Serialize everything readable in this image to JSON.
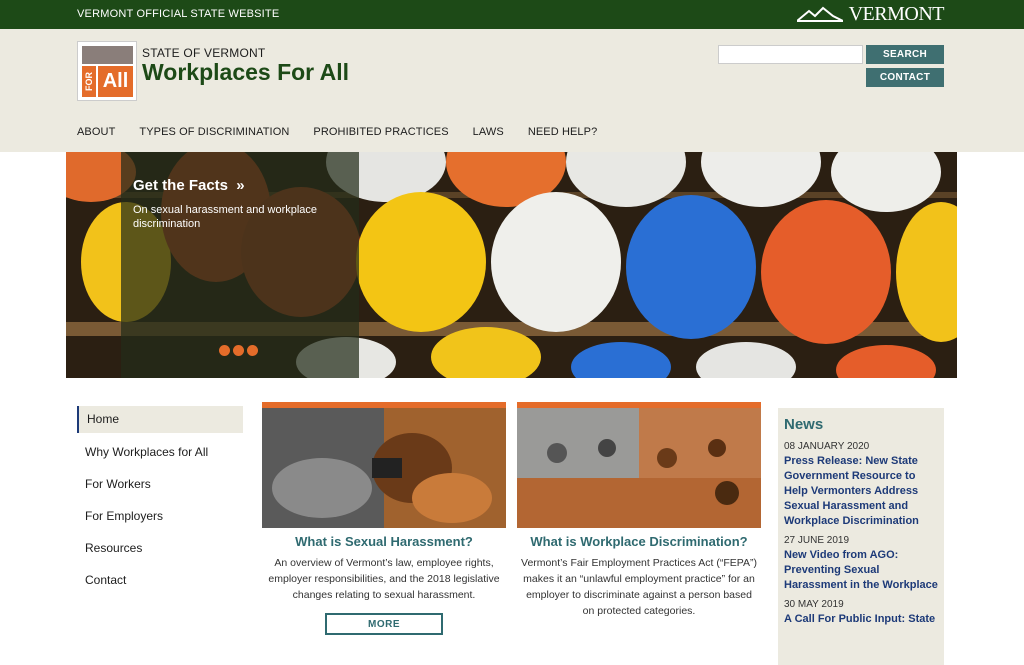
{
  "topbar": {
    "official": "VERMONT OFFICIAL STATE WEBSITE",
    "brand": "VERMONT"
  },
  "header": {
    "state": "STATE OF VERMONT",
    "title": "Workplaces For All",
    "logo_for": "FOR",
    "logo_all": "All",
    "search_label": "SEARCH",
    "contact_label": "CONTACT",
    "search_placeholder": ""
  },
  "nav": [
    "ABOUT",
    "TYPES OF DISCRIMINATION",
    "PROHIBITED PRACTICES",
    "LAWS",
    "NEED HELP?"
  ],
  "hero": {
    "title": "Get the Facts",
    "chevron": "»",
    "desc": "On sexual harassment and workplace discrimination",
    "slides": 3
  },
  "sidebar": [
    "Home",
    "Why Workplaces for All",
    "For Workers",
    "For Employers",
    "Resources",
    "Contact"
  ],
  "cards": [
    {
      "title": "What is Sexual Harassment?",
      "text": "An overview of Vermont’s law, employee rights, employer responsibilities, and the 2018 legislative changes relating to sexual harassment.",
      "button": "MORE"
    },
    {
      "title": "What is Workplace Discrimination?",
      "text": "Vermont’s Fair Employment Practices Act (“FEPA”) makes it an “unlawful employment practice” for an employer to discriminate against a person based on protected categories."
    }
  ],
  "news": {
    "title": "News",
    "items": [
      {
        "date": "08 JANUARY 2020",
        "headline": "Press Release: New State Government Resource to Help Vermonters Address Sexual Harassment and Workplace Discrimination"
      },
      {
        "date": "27 JUNE 2019",
        "headline": "New Video from AGO: Preventing Sexual Harassment in the Workplace"
      },
      {
        "date": "30 MAY 2019",
        "headline": "A Call For Public Input: State"
      }
    ]
  },
  "colors": {
    "topbar": "#1d4a17",
    "header_bg": "#eceae0",
    "accent": "#e46c2a",
    "teal": "#3f6f71",
    "link": "#1d3a78"
  }
}
